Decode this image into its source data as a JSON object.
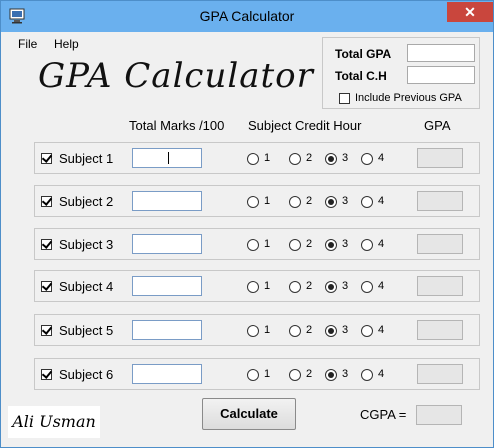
{
  "window": {
    "title": "GPA Calculator",
    "close_label": "✕"
  },
  "menu": {
    "file": "File",
    "help": "Help"
  },
  "header": {
    "big_title": "GPA Calculator"
  },
  "summary": {
    "total_gpa_label": "Total GPA",
    "total_ch_label": "Total C.H",
    "include_previous_label": "Include Previous GPA",
    "include_previous_checked": false
  },
  "columns": {
    "marks": "Total Marks /100",
    "credit": "Subject Credit Hour",
    "gpa": "GPA"
  },
  "radio_labels": [
    "1",
    "2",
    "3",
    "4"
  ],
  "subjects": [
    {
      "label": "Subject 1",
      "checked": true,
      "selected_credit": "3"
    },
    {
      "label": "Subject 2",
      "checked": true,
      "selected_credit": "3"
    },
    {
      "label": "Subject 3",
      "checked": true,
      "selected_credit": "3"
    },
    {
      "label": "Subject 4",
      "checked": true,
      "selected_credit": "3"
    },
    {
      "label": "Subject 5",
      "checked": true,
      "selected_credit": "3"
    },
    {
      "label": "Subject 6",
      "checked": true,
      "selected_credit": "3"
    }
  ],
  "footer": {
    "signature": "Ali Usman",
    "calculate_label": "Calculate",
    "cgpa_label": "CGPA ="
  }
}
